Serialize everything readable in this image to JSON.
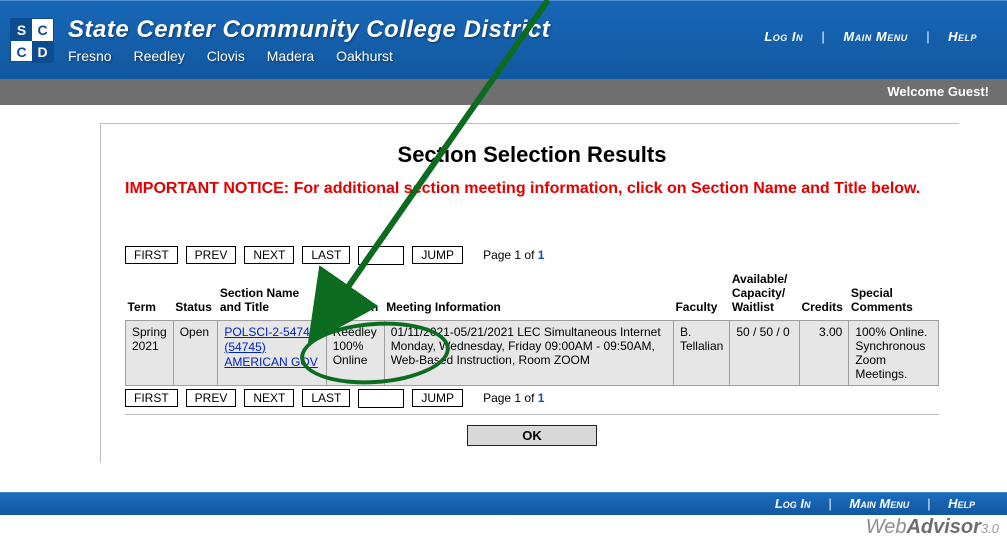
{
  "banner": {
    "org_name": "State Center Community College District",
    "campuses": [
      "Fresno",
      "Reedley",
      "Clovis",
      "Madera",
      "Oakhurst"
    ],
    "logo_letters": [
      "S",
      "C",
      "C",
      "D"
    ]
  },
  "nav": {
    "login": "Log In",
    "main_menu": "Main Menu",
    "help": "Help"
  },
  "welcome_text": "Welcome Guest!",
  "page_title": "Section Selection Results",
  "important_notice": "IMPORTANT NOTICE: For additional section meeting information, click on Section Name and Title below.",
  "pager": {
    "first": "FIRST",
    "prev": "PREV",
    "next": "NEXT",
    "last": "LAST",
    "jump": "JUMP",
    "page_info_prefix": "Page 1 of ",
    "page_total": "1",
    "jump_value": ""
  },
  "table": {
    "headers": {
      "term": "Term",
      "status": "Status",
      "section": "Section Name and Title",
      "location": "Location",
      "meeting": "Meeting Information",
      "faculty": "Faculty",
      "avail": "Available/ Capacity/ Waitlist",
      "credits": "Credits",
      "comments": "Special Comments"
    },
    "rows": [
      {
        "term": "Spring 2021",
        "status": "Open",
        "section_line1": "POLSCI-2-54745",
        "section_line2": "(54745)",
        "section_line3": "AMERICAN GOV",
        "location": "Reedley 100% Online",
        "meeting": "01/11/2021-05/21/2021 LEC Simultaneous Internet Monday, Wednesday, Friday 09:00AM - 09:50AM, Web-Based Instruction, Room ZOOM",
        "faculty": "B. Tellalian",
        "avail": "50 / 50 / 0",
        "credits": "3.00",
        "comments": "100% Online. Synchronous Zoom Meetings."
      }
    ]
  },
  "ok_label": "OK",
  "brand": {
    "part1": "Web",
    "part2": "Advisor",
    "part3": "3.0"
  }
}
